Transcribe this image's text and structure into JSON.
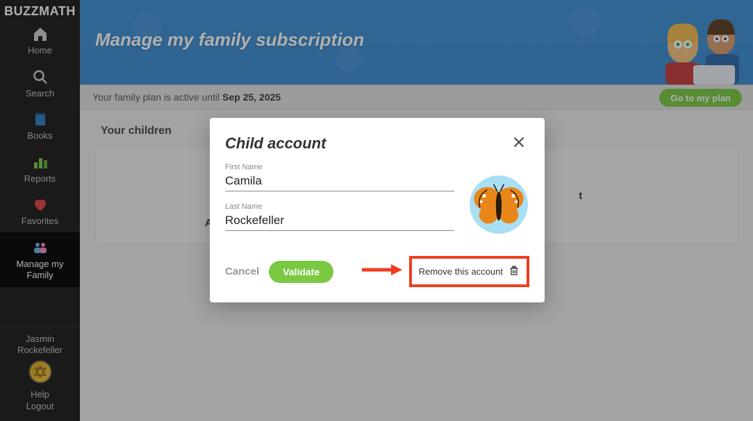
{
  "brand": "BUZZMATH",
  "sidebar": {
    "items": [
      {
        "label": "Home"
      },
      {
        "label": "Search"
      },
      {
        "label": "Books"
      },
      {
        "label": "Reports"
      },
      {
        "label": "Favorites"
      },
      {
        "label": "Manage my\nFamily"
      }
    ]
  },
  "user": {
    "name": "Jasmin\nRockefeller",
    "help": "Help",
    "logout": "Logout"
  },
  "banner": {
    "title": "Manage my family subscription"
  },
  "plan": {
    "prefix": "Your family plan is active until",
    "date": "Sep 25, 2025",
    "go_button": "Go to my plan"
  },
  "section": {
    "your_children": "Your children"
  },
  "children": [
    {
      "name": "Antony Rockefeller"
    },
    {
      "name": "t"
    }
  ],
  "modal": {
    "title": "Child account",
    "first_name_label": "First Name",
    "first_name_value": "Camila",
    "last_name_label": "Last Name",
    "last_name_value": "Rockefeller",
    "cancel": "Cancel",
    "validate": "Validate",
    "remove": "Remove this account"
  }
}
